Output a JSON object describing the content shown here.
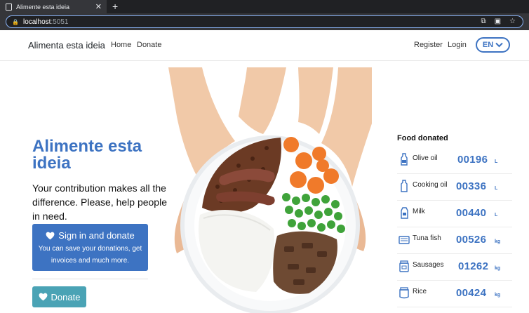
{
  "browser": {
    "tab_title": "Alimente esta ideia",
    "url_host": "localhost",
    "url_port": ":5051"
  },
  "navbar": {
    "brand": "Alimenta esta ideia",
    "home": "Home",
    "donate": "Donate",
    "register": "Register",
    "login": "Login",
    "language": "EN"
  },
  "hero": {
    "title": "Alimente esta ideia",
    "text": "Your contribution makes all the difference. Please, help people in need.",
    "signin_label": "Sign in and donate",
    "signin_sub": "You can save your donations, get invoices and much more.",
    "donate_label": "Donate"
  },
  "food_donated": {
    "title": "Food donated",
    "items": [
      {
        "name": "Olive oil",
        "value": "00196",
        "unit": "L",
        "icon": "bottle-icon"
      },
      {
        "name": "Cooking oil",
        "value": "00336",
        "unit": "L",
        "icon": "oil-bottle-icon"
      },
      {
        "name": "Milk",
        "value": "00440",
        "unit": "L",
        "icon": "milk-carton-icon"
      },
      {
        "name": "Tuna fish",
        "value": "00526",
        "unit": "kg",
        "icon": "tuna-can-icon"
      },
      {
        "name": "Sausages",
        "value": "01262",
        "unit": "kg",
        "icon": "sausage-jar-icon"
      },
      {
        "name": "Rice",
        "value": "00424",
        "unit": "kg",
        "icon": "rice-jar-icon"
      }
    ]
  },
  "colors": {
    "primary": "#3d73c2",
    "donate_button": "#4aa3b5"
  }
}
